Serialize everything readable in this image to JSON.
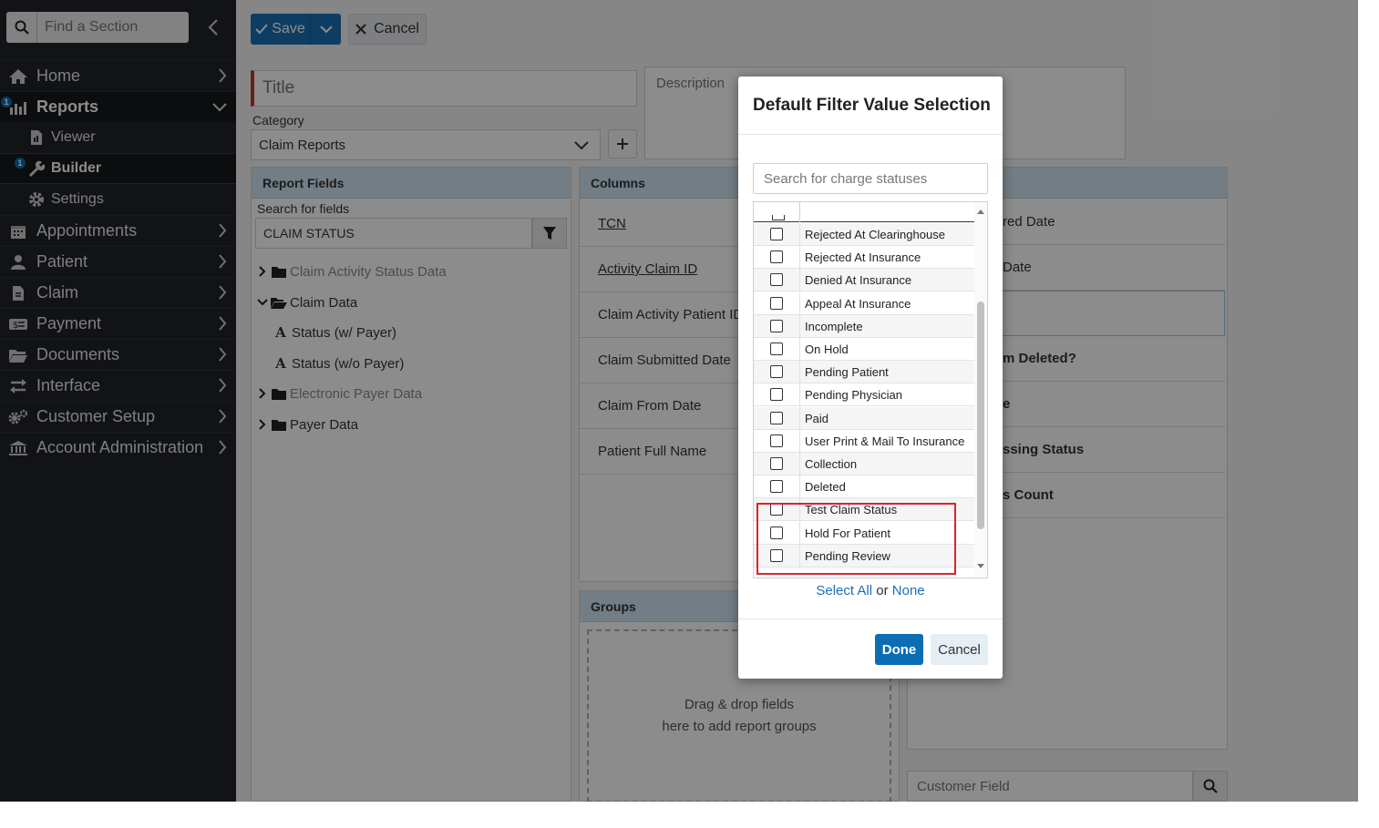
{
  "sidebar": {
    "search_placeholder": "Find a Section",
    "items": [
      {
        "label": "Home",
        "icon": "home-icon"
      },
      {
        "label": "Reports",
        "icon": "reports-icon",
        "badge": "1"
      },
      {
        "label": "Appointments",
        "icon": "calendar-icon"
      },
      {
        "label": "Patient",
        "icon": "user-icon"
      },
      {
        "label": "Claim",
        "icon": "document-icon"
      },
      {
        "label": "Payment",
        "icon": "money-icon"
      },
      {
        "label": "Documents",
        "icon": "folder-icon"
      },
      {
        "label": "Interface",
        "icon": "exchange-icon"
      },
      {
        "label": "Customer Setup",
        "icon": "gears-icon"
      },
      {
        "label": "Account Administration",
        "icon": "bank-icon"
      }
    ],
    "reports_sub": [
      {
        "label": "Viewer",
        "icon": "file-chart-icon"
      },
      {
        "label": "Builder",
        "icon": "wrench-icon",
        "badge": "1"
      },
      {
        "label": "Settings",
        "icon": "gear-icon"
      }
    ]
  },
  "toolbar": {
    "save_label": "Save",
    "cancel_label": "Cancel"
  },
  "form": {
    "title_placeholder": "Title",
    "category_label": "Category",
    "category_value": "Claim Reports",
    "description_placeholder": "Description"
  },
  "report_fields": {
    "header": "Report Fields",
    "search_label": "Search for fields",
    "search_value": "CLAIM STATUS",
    "tree": [
      {
        "label": "Claim Activity Status Data",
        "type": "folder",
        "expanded": false,
        "muted": true
      },
      {
        "label": "Claim Data",
        "type": "folder",
        "expanded": true,
        "muted": false
      },
      {
        "label": "Status (w/ Payer)",
        "type": "field"
      },
      {
        "label": "Status (w/o Payer)",
        "type": "field"
      },
      {
        "label": "Electronic Payer Data",
        "type": "folder",
        "expanded": false,
        "muted": true
      },
      {
        "label": "Payer Data",
        "type": "folder",
        "expanded": false,
        "muted": false
      }
    ]
  },
  "columns": {
    "header": "Columns",
    "items": [
      "TCN",
      "Activity Claim ID",
      "Claim Activity Patient ID",
      "Claim Submitted Date",
      "Claim From Date",
      "Patient Full Name"
    ]
  },
  "right_panel": {
    "items": [
      "red Date",
      "Date",
      "",
      "m Deleted?",
      "e",
      "ssing Status",
      "s Count"
    ],
    "customer_field_placeholder": "Customer Field"
  },
  "groups": {
    "header": "Groups",
    "drop_line1": "Drag & drop fields",
    "drop_line2": "here to add report groups"
  },
  "modal": {
    "title": "Default Filter Value Selection",
    "search_placeholder": "Search for charge statuses",
    "options": [
      "Rejected At Clearinghouse",
      "Rejected At Insurance",
      "Denied At Insurance",
      "Appeal At Insurance",
      "Incomplete",
      "On Hold",
      "Pending Patient",
      "Pending Physician",
      "Paid",
      "User Print & Mail To Insurance",
      "Collection",
      "Deleted",
      "Test Claim Status",
      "Hold For Patient",
      "Pending Review"
    ],
    "select_all_label": "Select All",
    "or_label": "or",
    "none_label": "None",
    "done_label": "Done",
    "cancel_label": "Cancel"
  },
  "colors": {
    "accent": "#1b6fb5",
    "sidebar_bg": "#1f2328",
    "panel_header": "#cfe3f2",
    "highlight": "#d9232d"
  }
}
